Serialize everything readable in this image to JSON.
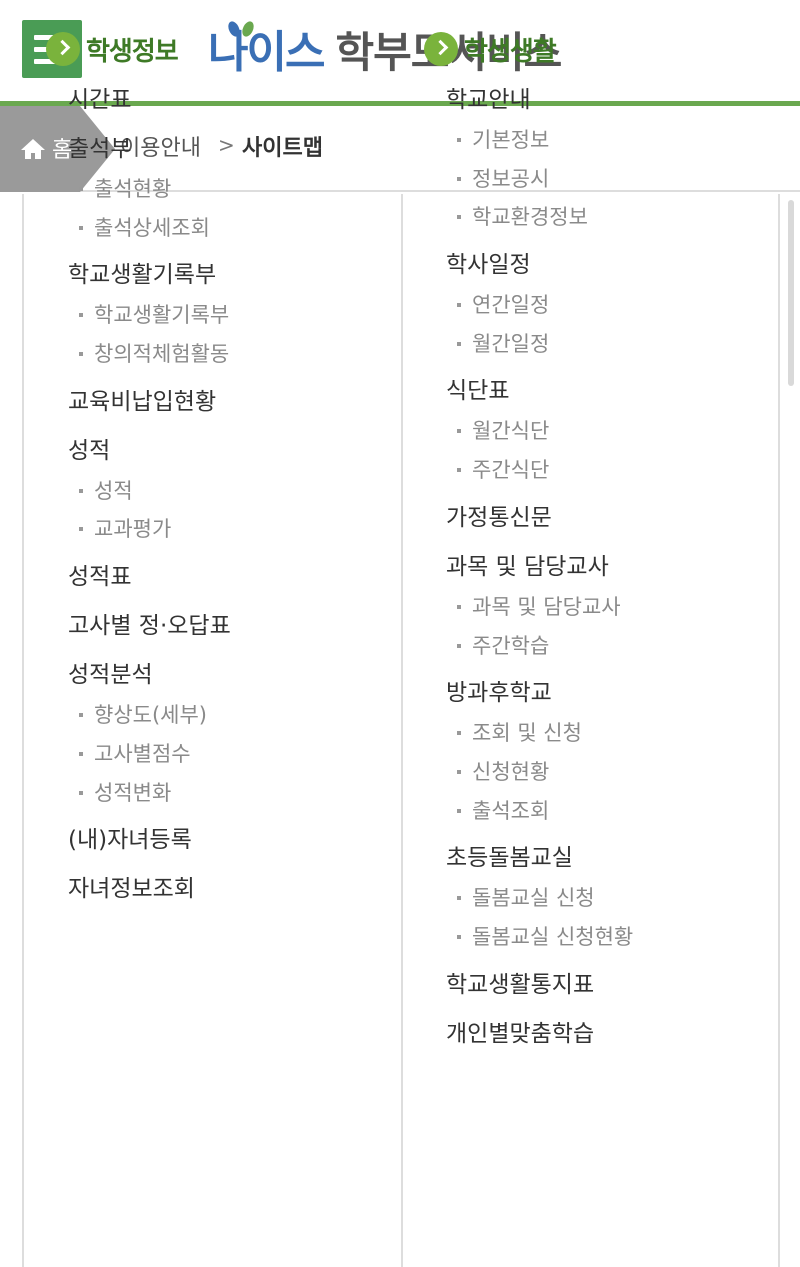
{
  "header": {
    "logo_main": "나이스",
    "logo_sub": "학부모서비스"
  },
  "breadcrumb": {
    "home": "홈",
    "level1": "이용안내",
    "current": "사이트맵"
  },
  "left": {
    "title": "학생정보",
    "items": [
      {
        "label": "시간표",
        "subs": []
      },
      {
        "label": "출석부",
        "subs": [
          "출석현황",
          "출석상세조회"
        ]
      },
      {
        "label": "학교생활기록부",
        "subs": [
          "학교생활기록부",
          "창의적체험활동"
        ]
      },
      {
        "label": "교육비납입현황",
        "subs": []
      },
      {
        "label": "성적",
        "subs": [
          "성적",
          "교과평가"
        ]
      },
      {
        "label": "성적표",
        "subs": []
      },
      {
        "label": "고사별 정·오답표",
        "subs": []
      },
      {
        "label": "성적분석",
        "subs": [
          "향상도(세부)",
          "고사별점수",
          "성적변화"
        ]
      },
      {
        "label": "(내)자녀등록",
        "subs": []
      },
      {
        "label": "자녀정보조회",
        "subs": []
      }
    ]
  },
  "right": {
    "title": "학생생활",
    "items": [
      {
        "label": "학교안내",
        "subs": [
          "기본정보",
          "정보공시",
          "학교환경정보"
        ]
      },
      {
        "label": "학사일정",
        "subs": [
          "연간일정",
          "월간일정"
        ]
      },
      {
        "label": "식단표",
        "subs": [
          "월간식단",
          "주간식단"
        ]
      },
      {
        "label": "가정통신문",
        "subs": []
      },
      {
        "label": "과목 및 담당교사",
        "subs": [
          "과목 및 담당교사",
          "주간학습"
        ]
      },
      {
        "label": "방과후학교",
        "subs": [
          "조회 및 신청",
          "신청현황",
          "출석조회"
        ]
      },
      {
        "label": "초등돌봄교실",
        "subs": [
          "돌봄교실 신청",
          "돌봄교실 신청현황"
        ]
      },
      {
        "label": "학교생활통지표",
        "subs": []
      },
      {
        "label": "개인별맞춤학습",
        "subs": []
      }
    ]
  },
  "colors": {
    "accent_green": "#6aa84f",
    "menu_green": "#4a9c55",
    "section_title": "#3e7a26",
    "logo_blue": "#3a6fb5"
  }
}
